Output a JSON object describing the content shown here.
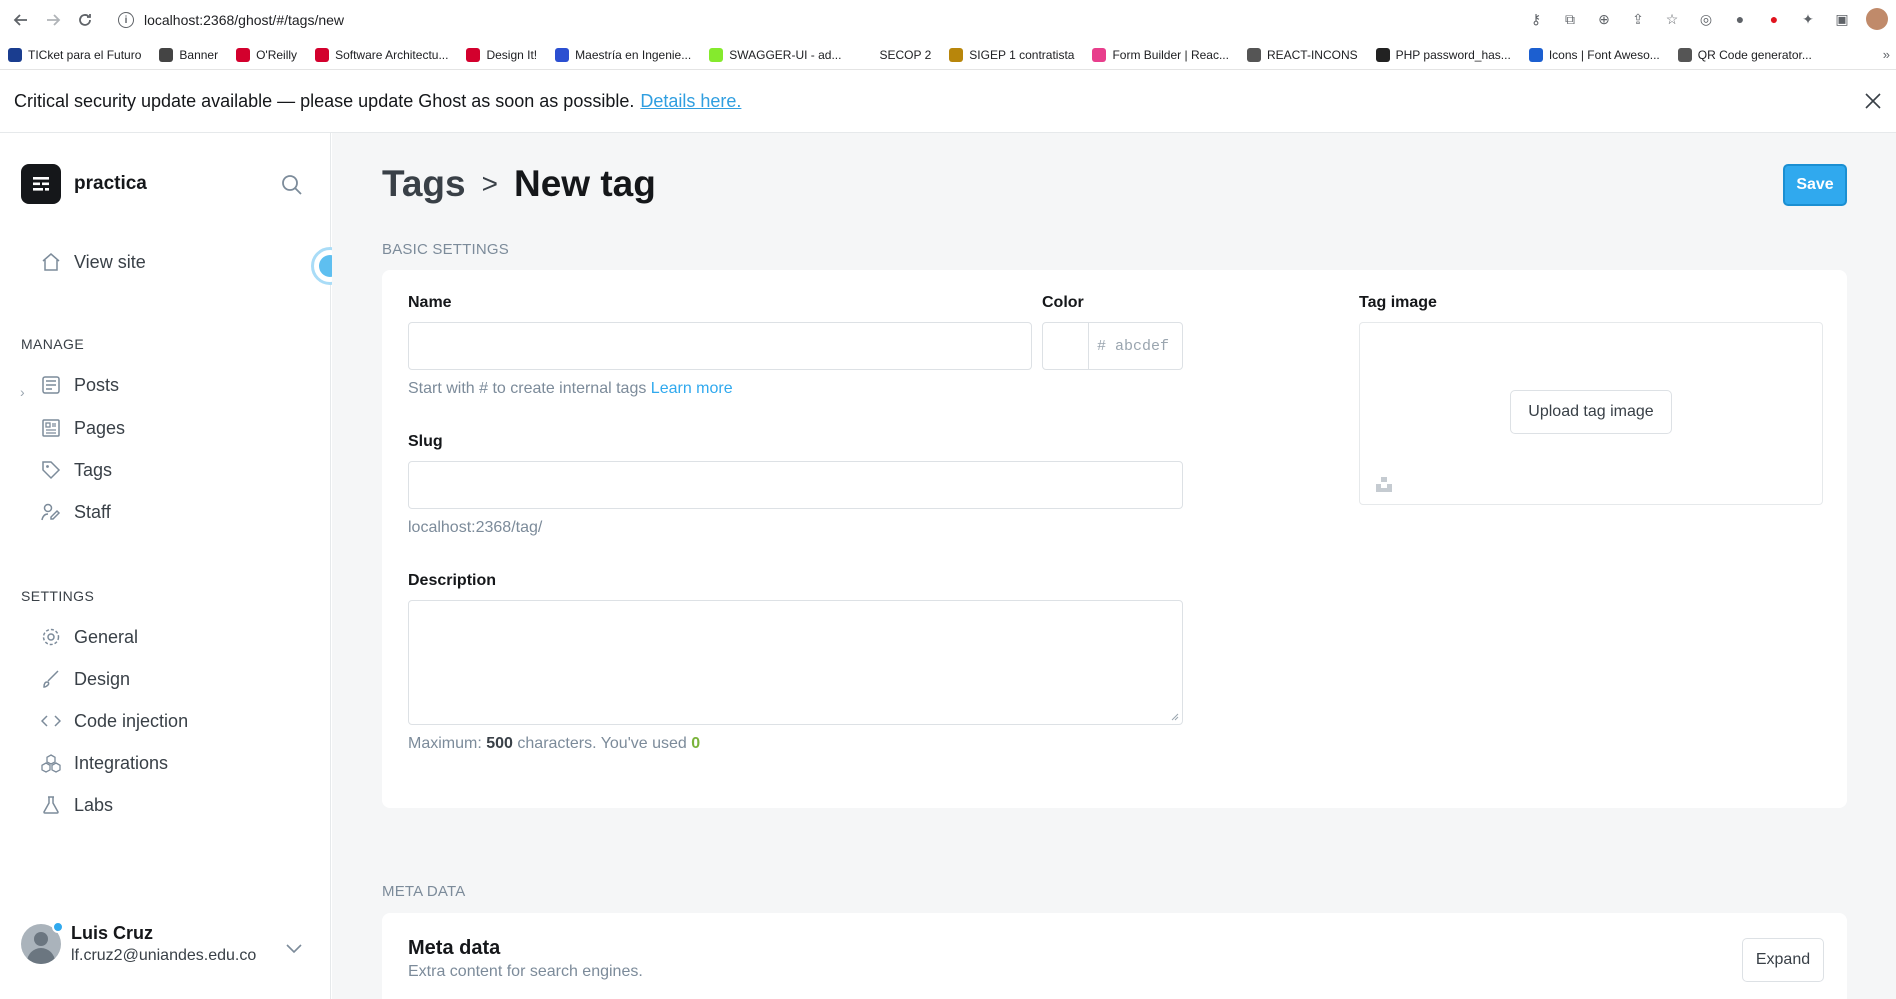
{
  "browser": {
    "url": "localhost:2368/ghost/#/tags/new",
    "bookmarks": [
      {
        "label": "TICket para el Futuro",
        "icon_color": "#1a3d8f"
      },
      {
        "label": "Banner",
        "icon_color": "#444444"
      },
      {
        "label": "O'Reilly",
        "icon_color": "#d3002d"
      },
      {
        "label": "Software Architectu...",
        "icon_color": "#d3002d"
      },
      {
        "label": "Design It!",
        "icon_color": "#d3002d"
      },
      {
        "label": "Maestría en Ingenie...",
        "icon_color": "#2b4fd1"
      },
      {
        "label": "SWAGGER-UI - ad...",
        "icon_color": "#85ea2d"
      },
      {
        "label": "SECOP 2",
        "icon_color": "#ffffff"
      },
      {
        "label": "SIGEP 1 contratista",
        "icon_color": "#b8860b"
      },
      {
        "label": "Form Builder | Reac...",
        "icon_color": "#e83e8c"
      },
      {
        "label": "REACT-INCONS",
        "icon_color": "#555555"
      },
      {
        "label": "PHP password_has...",
        "icon_color": "#222222"
      },
      {
        "label": "Icons | Font Aweso...",
        "icon_color": "#1c5fd0"
      },
      {
        "label": "QR Code generator...",
        "icon_color": "#555555"
      }
    ],
    "more": "»"
  },
  "banner": {
    "text": "Critical security update available — please update Ghost as soon as possible.",
    "link": "Details here."
  },
  "sidebar": {
    "site_name": "practica",
    "view_site": "View site",
    "manage_label": "MANAGE",
    "manage_items": [
      "Posts",
      "Pages",
      "Tags",
      "Staff"
    ],
    "settings_label": "SETTINGS",
    "settings_items": [
      "General",
      "Design",
      "Code injection",
      "Integrations",
      "Labs"
    ],
    "user": {
      "name": "Luis Cruz",
      "email": "lf.cruz2@uniandes.edu.co"
    }
  },
  "main": {
    "breadcrumb_parent": "Tags",
    "breadcrumb_sep": ">",
    "title": "New tag",
    "save": "Save",
    "basic_label": "BASIC SETTINGS",
    "name_label": "Name",
    "name_value": "",
    "name_hint": "Start with # to create internal tags",
    "learn_more": "Learn more",
    "color_label": "Color",
    "color_placeholder": "# abcdef",
    "slug_label": "Slug",
    "slug_value": "",
    "slug_hint": "localhost:2368/tag/",
    "description_label": "Description",
    "description_value": "",
    "desc_hint_prefix": "Maximum:",
    "desc_max": "500",
    "desc_hint_mid": "characters. You've used",
    "desc_used": "0",
    "tag_image_label": "Tag image",
    "upload_label": "Upload tag image",
    "meta_label": "META DATA",
    "meta_title": "Meta data",
    "meta_sub": "Extra content for search engines.",
    "expand": "Expand"
  },
  "colors": {
    "accent": "#30a9ee",
    "used_green": "#7ab33b"
  }
}
